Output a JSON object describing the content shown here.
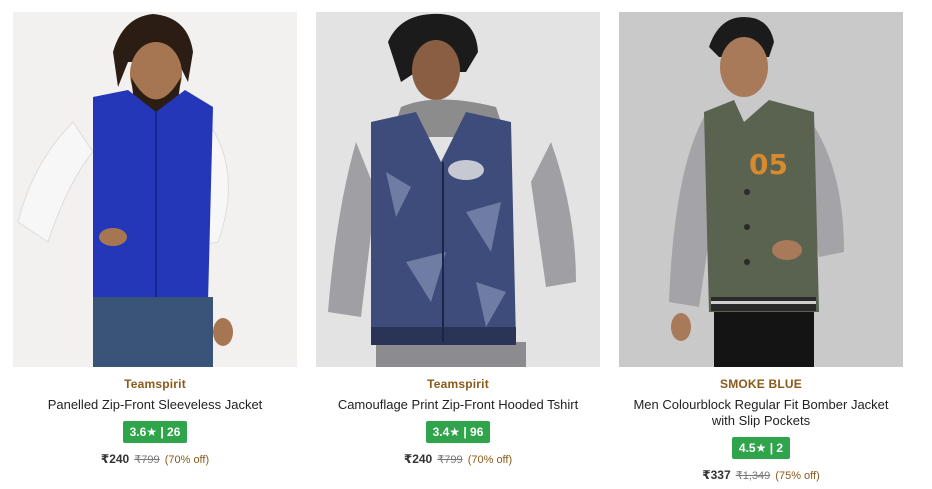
{
  "products": [
    {
      "brand": "Teamspirit",
      "title": "Panelled Zip-Front Sleeveless Jacket",
      "rating": "3.6★ | 26",
      "price": "₹240",
      "mrp": "₹799",
      "discount": "(70% off)",
      "image_icon": "blue-sleeveless-jacket-photo"
    },
    {
      "brand": "Teamspirit",
      "title": "Camouflage Print Zip-Front Hooded Tshirt",
      "rating": "3.4★ | 96",
      "price": "₹240",
      "mrp": "₹799",
      "discount": "(70% off)",
      "image_icon": "camouflage-hooded-vest-photo"
    },
    {
      "brand": "SMOKE BLUE",
      "title": "Men Colourblock Regular Fit Bomber Jacket with Slip Pockets",
      "rating": "4.5★ | 2",
      "price": "₹337",
      "mrp": "₹1,349",
      "discount": "(75% off)",
      "image_icon": "olive-bomber-jacket-photo"
    }
  ],
  "colors": {
    "brand": "#8a5a1a",
    "rating_bg": "#2fa44b",
    "discount": "#8a5a1a"
  }
}
